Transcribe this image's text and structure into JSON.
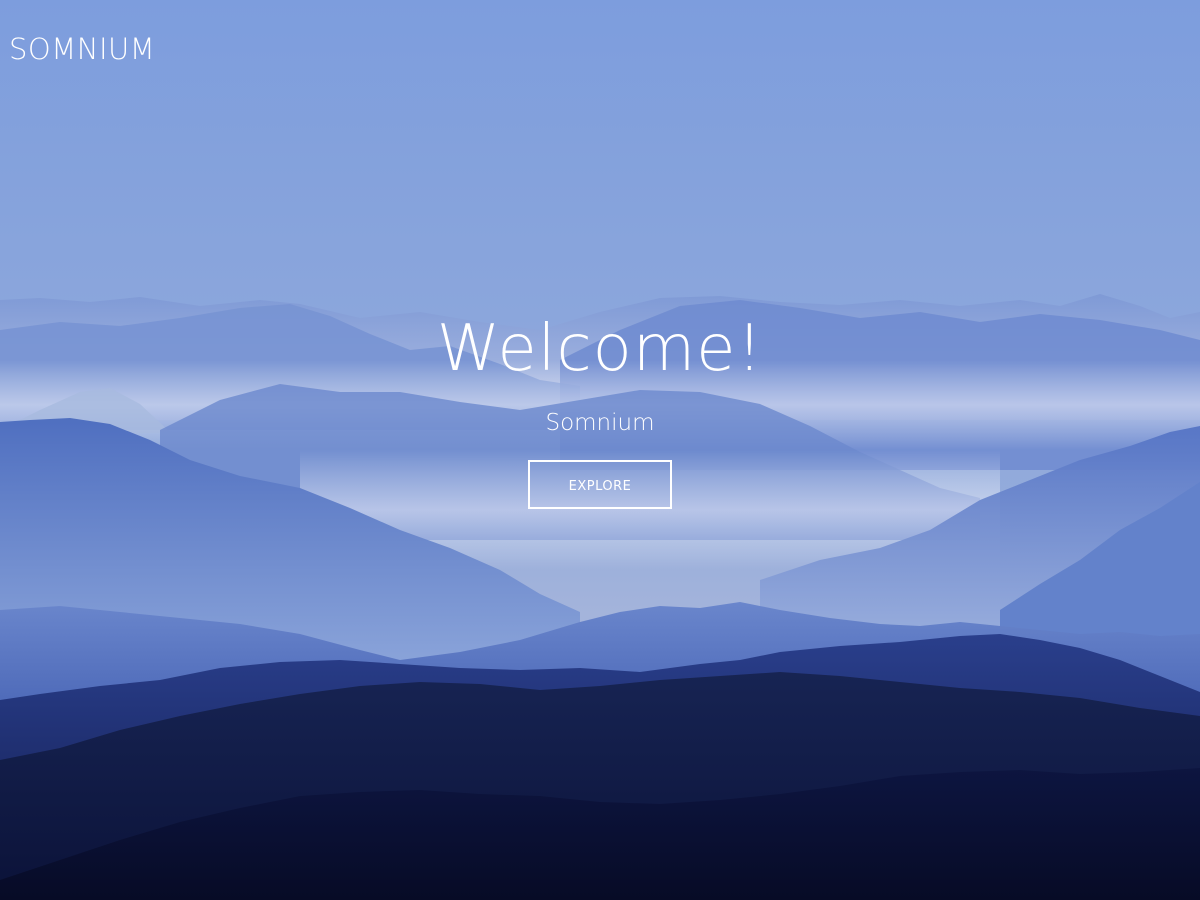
{
  "header": {
    "brand": "SOMNIUM"
  },
  "hero": {
    "heading": "Welcome!",
    "subheading": "Somnium",
    "cta_label": "EXPLORE"
  },
  "colors": {
    "sky_top": "#7f9fde",
    "horizon_glow": "#d6cbd8",
    "mountain_far": "#8da6dd",
    "mountain_mid": "#5d7ecb",
    "mountain_dark": "#1f2f6e",
    "foreground": "#0a1136",
    "text": "#ffffff"
  }
}
